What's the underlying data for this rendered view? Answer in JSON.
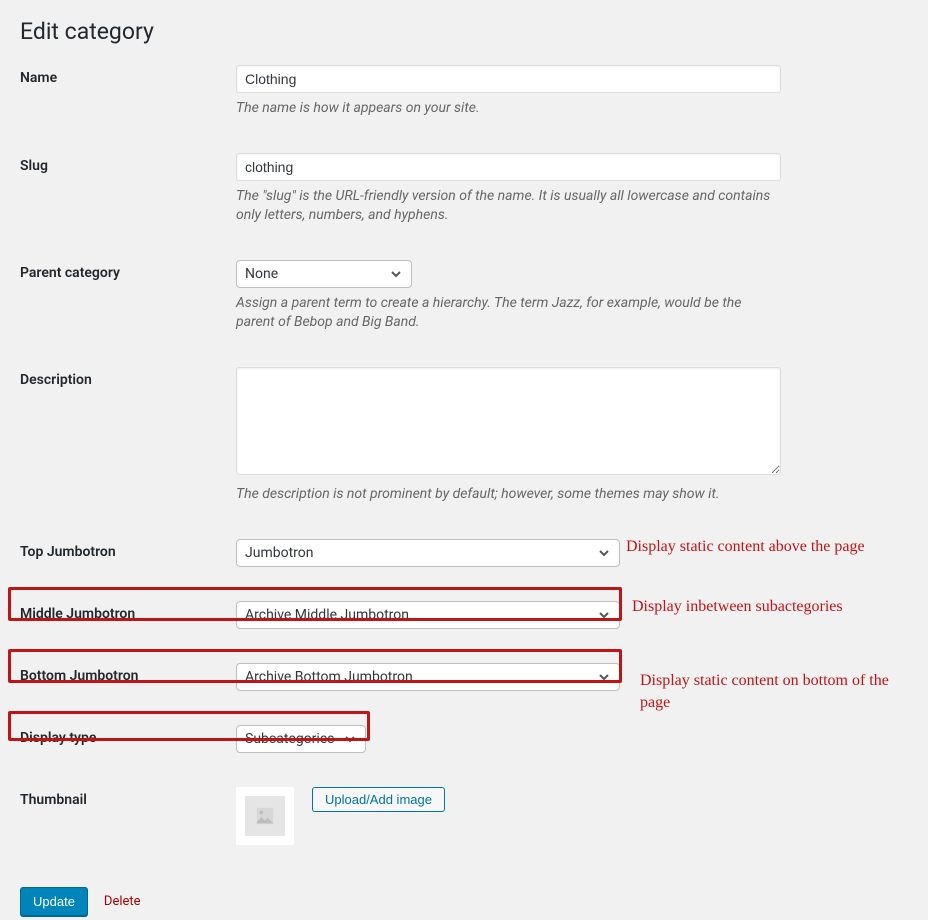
{
  "page_title": "Edit category",
  "fields": {
    "name": {
      "label": "Name",
      "value": "Clothing",
      "help": "The name is how it appears on your site."
    },
    "slug": {
      "label": "Slug",
      "value": "clothing",
      "help": "The \"slug\" is the URL-friendly version of the name. It is usually all lowercase and contains only letters, numbers, and hyphens."
    },
    "parent": {
      "label": "Parent category",
      "value": "None",
      "help": "Assign a parent term to create a hierarchy. The term Jazz, for example, would be the parent of Bebop and Big Band."
    },
    "description": {
      "label": "Description",
      "value": "",
      "help": "The description is not prominent by default; however, some themes may show it."
    },
    "top_jumbotron": {
      "label": "Top Jumbotron",
      "value": "Jumbotron",
      "annotation": "Display static content above the page"
    },
    "middle_jumbotron": {
      "label": "Middle Jumbotron",
      "value": "Archive Middle Jumbotron",
      "annotation": "Display inbetween subactegories"
    },
    "bottom_jumbotron": {
      "label": "Bottom Jumbotron",
      "value": "Archive Bottom Jumbotron",
      "annotation": "Display static content on bottom of the page"
    },
    "display_type": {
      "label": "Display type",
      "value": "Subcategories"
    },
    "thumbnail": {
      "label": "Thumbnail",
      "button": "Upload/Add image"
    }
  },
  "actions": {
    "update": "Update",
    "delete": "Delete"
  }
}
